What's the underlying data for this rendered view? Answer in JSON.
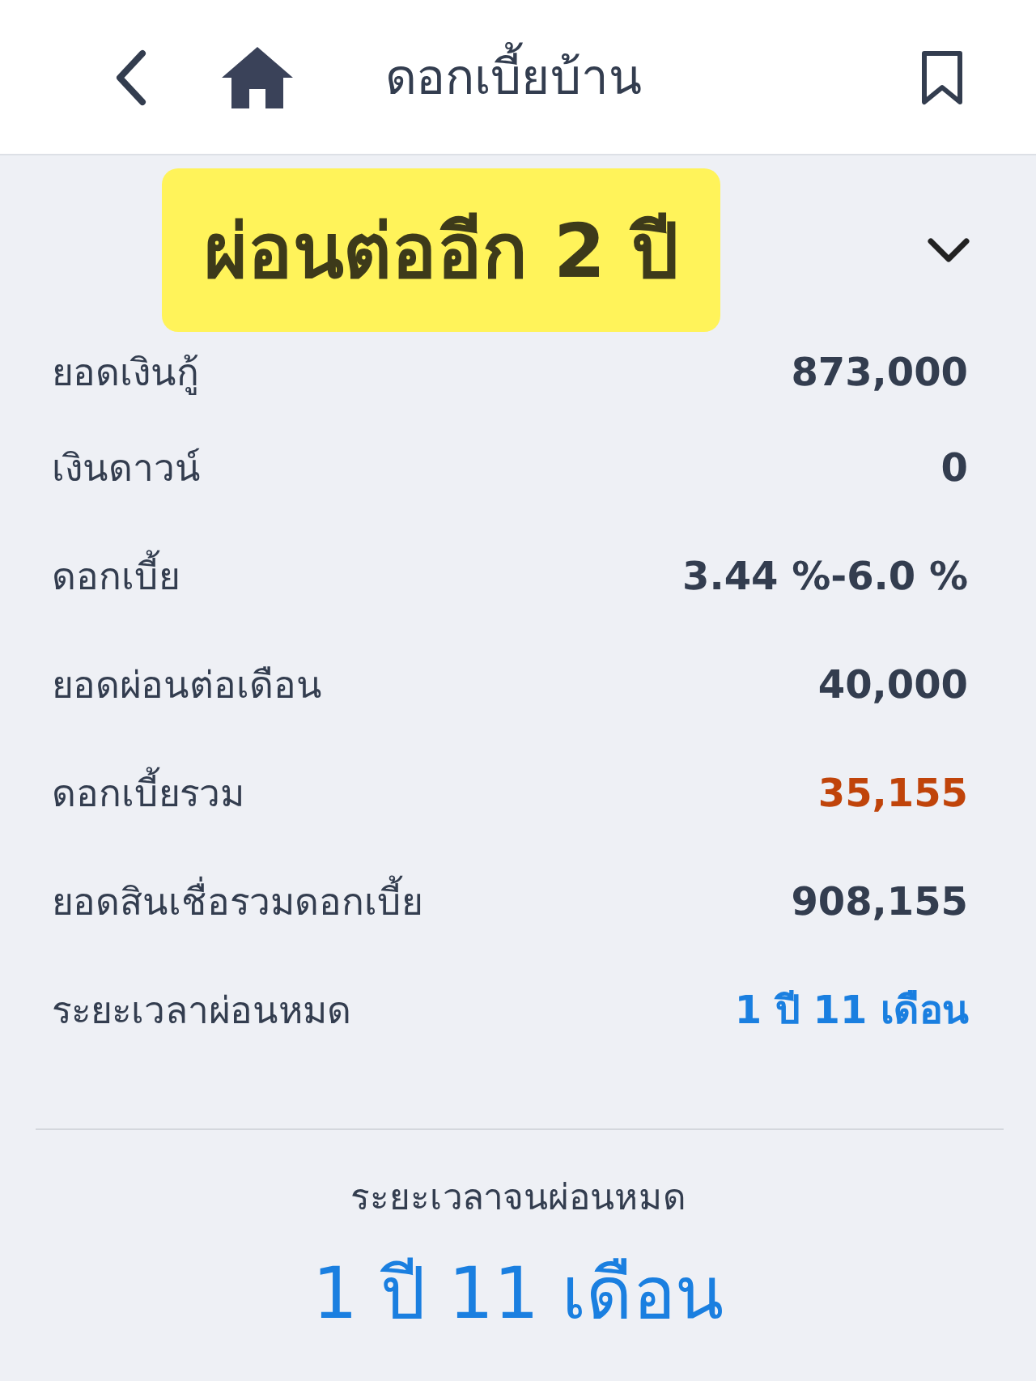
{
  "header": {
    "title": "ดอกเบี้ยบ้าน"
  },
  "banner": {
    "text": "ผ่อนต่ออีก 2 ปี"
  },
  "rows": [
    {
      "label": "ยอดเงินกู้",
      "value": "873,000",
      "color": "#333d4f"
    },
    {
      "label": "เงินดาวน์",
      "value": "0",
      "color": "#333d4f"
    },
    {
      "label": "ดอกเบี้ย",
      "value": "3.44 %-6.0 %",
      "color": "#333d4f"
    },
    {
      "label": "ยอดผ่อนต่อเดือน",
      "value": "40,000",
      "color": "#333d4f"
    },
    {
      "label": "ดอกเบี้ยรวม",
      "value": "35,155",
      "color": "#c0440a"
    },
    {
      "label": "ยอดสินเชื่อรวมดอกเบี้ย",
      "value": "908,155",
      "color": "#333d4f"
    },
    {
      "label": "ระยะเวลาผ่อนหมด",
      "value": "1 ปี 11 เดือน",
      "color": "#1a7fe0"
    }
  ],
  "summary": {
    "label": "ระยะเวลาจนผ่อนหมด",
    "value": "1 ปี 11 เดือน"
  }
}
